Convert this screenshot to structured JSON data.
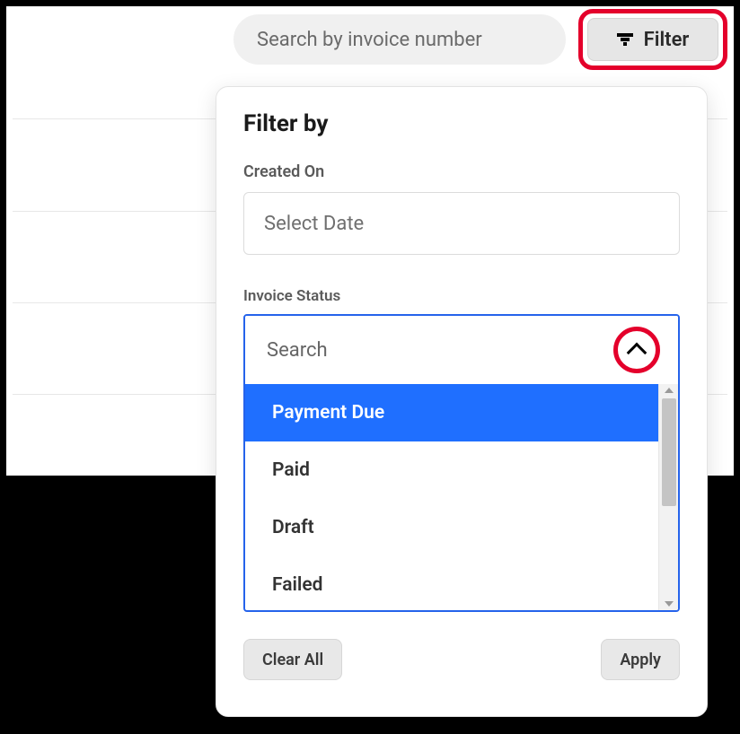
{
  "search": {
    "placeholder": "Search by invoice number"
  },
  "filter_button": {
    "label": "Filter"
  },
  "panel": {
    "title": "Filter by",
    "created_on": {
      "label": "Created On",
      "placeholder": "Select Date"
    },
    "invoice_status": {
      "label": "Invoice Status",
      "search_placeholder": "Search",
      "options": [
        "Payment Due",
        "Paid",
        "Draft",
        "Failed"
      ],
      "selected_index": 0
    },
    "actions": {
      "clear": "Clear All",
      "apply": "Apply"
    }
  }
}
